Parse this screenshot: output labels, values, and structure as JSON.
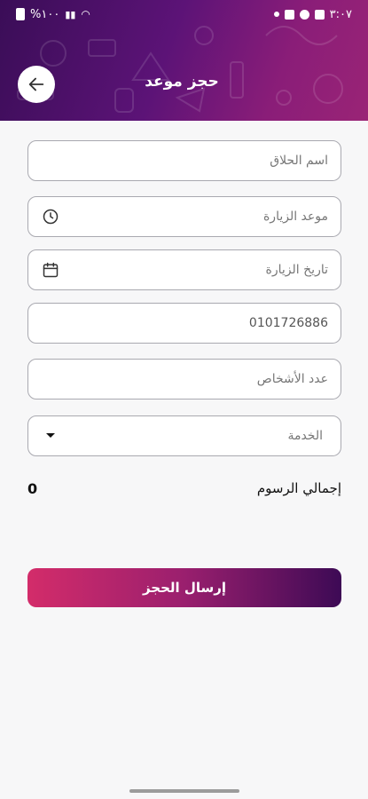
{
  "status_bar": {
    "time": "٣:٠٧",
    "battery": "%١٠٠"
  },
  "header": {
    "title": "حجز موعد",
    "back_icon": "arrow-left-icon"
  },
  "form": {
    "barber_name": {
      "placeholder": "اسم الحلاق"
    },
    "visit_time": {
      "placeholder": "موعد الزيارة",
      "icon": "clock-icon"
    },
    "visit_date": {
      "placeholder": "تاريخ الزيارة",
      "icon": "calendar-icon"
    },
    "phone": {
      "value": "0101726886"
    },
    "people_count": {
      "placeholder": "عدد الأشخاص"
    },
    "service": {
      "placeholder": "الخدمة",
      "icon": "dropdown-arrow-icon"
    }
  },
  "total": {
    "label": "إجمالي الرسوم",
    "value": "0"
  },
  "submit_label": "إرسال الحجز",
  "colors": {
    "header_start": "#3a0d57",
    "header_end": "#9a2476",
    "button_start": "#d32c6a",
    "button_end": "#3d0a55"
  }
}
